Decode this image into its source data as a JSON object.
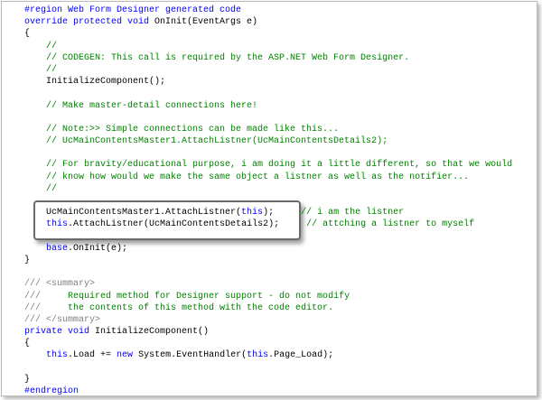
{
  "code_lines": [
    [
      {
        "t": "#region Web Form Designer generated code",
        "c": "kw"
      }
    ],
    [
      {
        "t": "override protected void ",
        "c": "kw"
      },
      {
        "t": "OnInit(EventArgs e)",
        "c": "n"
      }
    ],
    [
      {
        "t": "{",
        "c": "n"
      }
    ],
    [
      {
        "t": "    //",
        "c": "cm"
      }
    ],
    [
      {
        "t": "    // CODEGEN: This call is required by the ASP.NET Web Form Designer.",
        "c": "cm"
      }
    ],
    [
      {
        "t": "    //",
        "c": "cm"
      }
    ],
    [
      {
        "t": "    InitializeComponent();",
        "c": "n"
      }
    ],
    [],
    [
      {
        "t": "    // Make master-detail connections here!",
        "c": "cm"
      }
    ],
    [],
    [
      {
        "t": "    // Note:>> Simple connections can be made like this...",
        "c": "cm"
      }
    ],
    [
      {
        "t": "    // UcMainContentsMaster1.AttachListner(UcMainContentsDetails2);",
        "c": "cm"
      }
    ],
    [],
    [
      {
        "t": "    // For bravity/educational purpose, i am doing it a little different, so that we would",
        "c": "cm"
      }
    ],
    [
      {
        "t": "    // know how would we make the same object a listner as well as the notifier...",
        "c": "cm"
      }
    ],
    [
      {
        "t": "    //",
        "c": "cm"
      }
    ],
    [],
    [
      {
        "t": "    UcMainContentsMaster1.AttachListner(",
        "c": "n"
      },
      {
        "t": "this",
        "c": "kw"
      },
      {
        "t": ");     ",
        "c": "n"
      },
      {
        "t": "// i am the listner",
        "c": "cm"
      }
    ],
    [
      {
        "t": "    ",
        "c": "n"
      },
      {
        "t": "this",
        "c": "kw"
      },
      {
        "t": ".AttachListner(UcMainContentsDetails2);     ",
        "c": "n"
      },
      {
        "t": "// attching a listner to myself",
        "c": "cm"
      }
    ],
    [],
    [
      {
        "t": "    ",
        "c": "n"
      },
      {
        "t": "base",
        "c": "kw"
      },
      {
        "t": ".OnInit(e);",
        "c": "n"
      }
    ],
    [
      {
        "t": "}",
        "c": "n"
      }
    ],
    [],
    [
      {
        "t": "/// <summary>",
        "c": "dc"
      }
    ],
    [
      {
        "t": "///     ",
        "c": "dc"
      },
      {
        "t": "Required method for Designer support - do not modify",
        "c": "cm"
      }
    ],
    [
      {
        "t": "///     ",
        "c": "dc"
      },
      {
        "t": "the contents of this method with the code editor.",
        "c": "cm"
      }
    ],
    [
      {
        "t": "/// </summary>",
        "c": "dc"
      }
    ],
    [
      {
        "t": "private void ",
        "c": "kw"
      },
      {
        "t": "InitializeComponent()",
        "c": "n"
      }
    ],
    [
      {
        "t": "{",
        "c": "n"
      }
    ],
    [
      {
        "t": "    ",
        "c": "n"
      },
      {
        "t": "this",
        "c": "kw"
      },
      {
        "t": ".Load += ",
        "c": "n"
      },
      {
        "t": "new ",
        "c": "kw"
      },
      {
        "t": "System.EventHandler(",
        "c": "n"
      },
      {
        "t": "this",
        "c": "kw"
      },
      {
        "t": ".Page_Load);",
        "c": "n"
      }
    ],
    [],
    [
      {
        "t": "}",
        "c": "n"
      }
    ],
    [
      {
        "t": "#endregion",
        "c": "kw"
      }
    ]
  ],
  "colors": {
    "keyword": "#0000ff",
    "comment": "#008000",
    "doc_tag": "#808080",
    "text": "#000000"
  }
}
